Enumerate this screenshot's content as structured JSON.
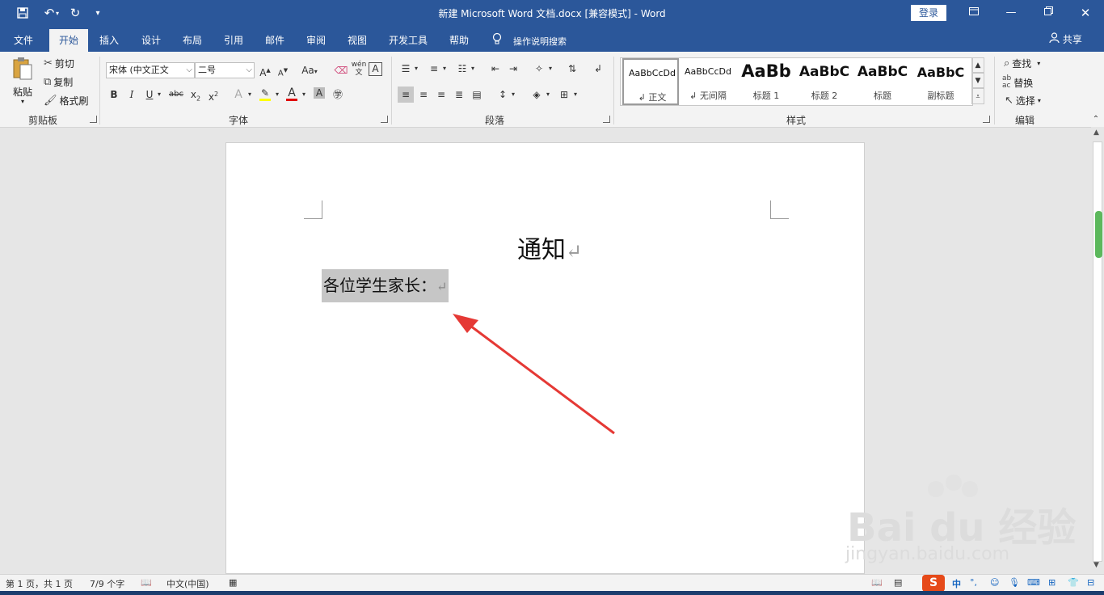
{
  "window": {
    "title": "新建 Microsoft Word 文档.docx [兼容模式] - Word",
    "login_label": "登录"
  },
  "tabs": [
    "文件",
    "开始",
    "插入",
    "设计",
    "布局",
    "引用",
    "邮件",
    "审阅",
    "视图",
    "开发工具",
    "帮助"
  ],
  "active_tab": "开始",
  "tell_me": "操作说明搜索",
  "share_label": "共享",
  "clipboard": {
    "paste": "粘贴",
    "cut": "剪切",
    "copy": "复制",
    "format_painter": "格式刷",
    "group": "剪贴板"
  },
  "font": {
    "name": "宋体 (中文正文",
    "size": "二号",
    "group": "字体",
    "case_label": "Aa",
    "phonetic": "wén"
  },
  "paragraph": {
    "group": "段落"
  },
  "styles": {
    "group": "样式",
    "items": [
      {
        "preview": "AaBbCcDd",
        "name": "↲ 正文"
      },
      {
        "preview": "AaBbCcDd",
        "name": "↲ 无间隔"
      },
      {
        "preview": "AaBb",
        "name": "标题 1"
      },
      {
        "preview": "AaBbC",
        "name": "标题 2"
      },
      {
        "preview": "AaBbC",
        "name": "标题"
      },
      {
        "preview": "AaBbC",
        "name": "副标题"
      }
    ]
  },
  "editing": {
    "find": "查找",
    "replace": "替换",
    "select": "选择",
    "group": "编辑"
  },
  "document": {
    "heading": "通知",
    "salutation": "各位学生家长：",
    "return_mark": "↵"
  },
  "status": {
    "page": "第 1 页，共 1 页",
    "words": "7/9 个字",
    "language": "中文(中国)"
  },
  "ime": {
    "mode": "中",
    "badge": "S"
  },
  "watermark": {
    "brand": "Bai du 经验",
    "url": "jingyan.baidu.com"
  },
  "colors": {
    "accent": "#2b579a",
    "arrow": "#e53935",
    "highlight_bar": "#ffff00",
    "font_color_bar": "#e00000"
  }
}
